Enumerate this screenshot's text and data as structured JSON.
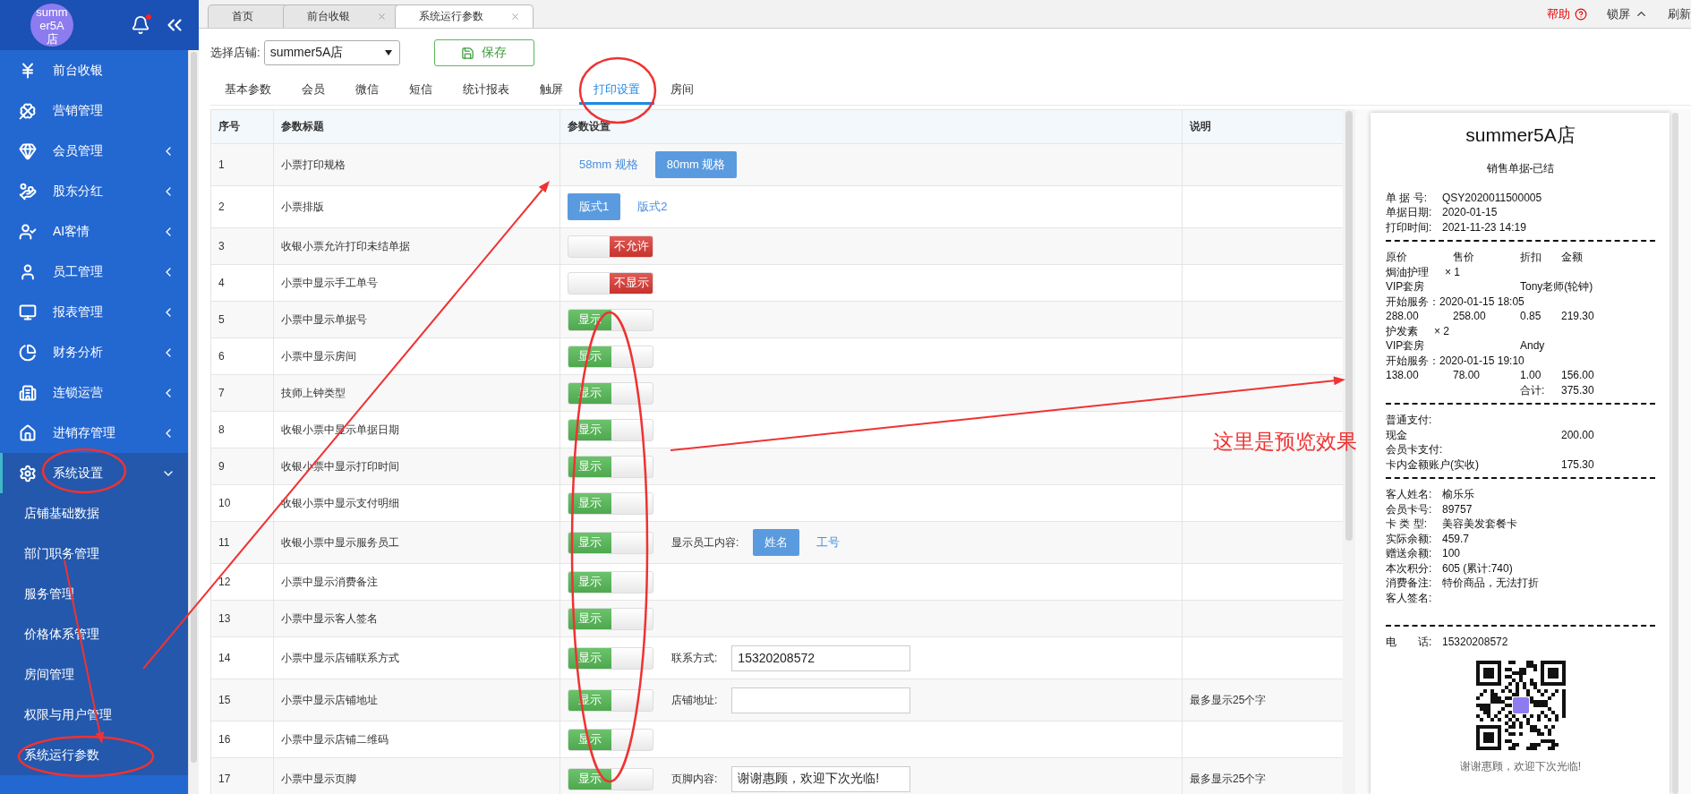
{
  "sidebar": {
    "shop_avatar": "summer5A店",
    "menu": [
      {
        "label": "前台收银",
        "kind": "link"
      },
      {
        "label": "营销管理",
        "kind": "link"
      },
      {
        "label": "会员管理",
        "kind": "group",
        "expanded": false
      },
      {
        "label": "股东分红",
        "kind": "group",
        "expanded": false
      },
      {
        "label": "AI客情",
        "kind": "group",
        "expanded": false
      },
      {
        "label": "员工管理",
        "kind": "group",
        "expanded": false
      },
      {
        "label": "报表管理",
        "kind": "group",
        "expanded": false
      },
      {
        "label": "财务分析",
        "kind": "group",
        "expanded": false
      },
      {
        "label": "连锁运营",
        "kind": "group",
        "expanded": false
      },
      {
        "label": "进销存管理",
        "kind": "group",
        "expanded": false
      },
      {
        "label": "系统设置",
        "kind": "group",
        "expanded": true,
        "children": [
          {
            "label": "店铺基础数据"
          },
          {
            "label": "部门职务管理"
          },
          {
            "label": "服务管理"
          },
          {
            "label": "价格体系管理"
          },
          {
            "label": "房间管理"
          },
          {
            "label": "权限与用户管理"
          },
          {
            "label": "系统运行参数"
          }
        ]
      }
    ]
  },
  "page_tabs": [
    {
      "label": "首页",
      "selected": false,
      "closable": false
    },
    {
      "label": "前台收银",
      "selected": false,
      "closable": true
    },
    {
      "label": "系统运行参数",
      "selected": true,
      "closable": true
    }
  ],
  "header_actions": [
    {
      "label": "帮助",
      "kind": "help"
    },
    {
      "label": "锁屏",
      "kind": "lock"
    },
    {
      "label": "刷新",
      "kind": "refresh"
    }
  ],
  "toolbar": {
    "store_label": "选择店铺:",
    "store_value": "summer5A店",
    "save": "保存"
  },
  "settings_tabs": [
    {
      "label": "基本参数",
      "selected": false
    },
    {
      "label": "会员",
      "selected": false
    },
    {
      "label": "微信",
      "selected": false
    },
    {
      "label": "短信",
      "selected": false
    },
    {
      "label": "统计报表",
      "selected": false
    },
    {
      "label": "触屏",
      "selected": false
    },
    {
      "label": "打印设置",
      "selected": true
    },
    {
      "label": "房间",
      "selected": false
    }
  ],
  "table": {
    "columns": [
      "序号",
      "参数标题",
      "参数设置",
      "说明"
    ],
    "rows": [
      {
        "no": "1",
        "title": "小票打印规格",
        "setting": {
          "kind": "choice",
          "options": [
            {
              "label": "58mm 规格",
              "selected": false
            },
            {
              "label": "80mm 规格",
              "selected": true
            }
          ]
        }
      },
      {
        "no": "2",
        "title": "小票排版",
        "setting": {
          "kind": "choice",
          "options": [
            {
              "label": "版式1",
              "selected": true
            },
            {
              "label": "版式2",
              "selected": false
            }
          ]
        }
      },
      {
        "no": "3",
        "title": "收银小票允许打印未结单据",
        "setting": {
          "kind": "toggle",
          "on": false,
          "label": "不允许"
        }
      },
      {
        "no": "4",
        "title": "小票中显示手工单号",
        "setting": {
          "kind": "toggle",
          "on": false,
          "label": "不显示"
        }
      },
      {
        "no": "5",
        "title": "小票中显示单据号",
        "setting": {
          "kind": "toggle",
          "on": true,
          "label": "显示"
        }
      },
      {
        "no": "6",
        "title": "小票中显示房间",
        "setting": {
          "kind": "toggle",
          "on": true,
          "label": "显示"
        }
      },
      {
        "no": "7",
        "title": "技师上钟类型",
        "setting": {
          "kind": "toggle",
          "on": true,
          "label": "显示"
        }
      },
      {
        "no": "8",
        "title": "收银小票中显示单据日期",
        "setting": {
          "kind": "toggle",
          "on": true,
          "label": "显示"
        }
      },
      {
        "no": "9",
        "title": "收银小票中显示打印时间",
        "setting": {
          "kind": "toggle",
          "on": true,
          "label": "显示"
        }
      },
      {
        "no": "10",
        "title": "收银小票中显示支付明细",
        "setting": {
          "kind": "toggle",
          "on": true,
          "label": "显示"
        }
      },
      {
        "no": "11",
        "title": "收银小票中显示服务员工",
        "setting": {
          "kind": "toggle",
          "on": true,
          "label": "显示"
        },
        "extra": {
          "kind": "choice",
          "label": "显示员工内容:",
          "options": [
            {
              "label": "姓名",
              "selected": true
            },
            {
              "label": "工号",
              "selected": false
            }
          ]
        }
      },
      {
        "no": "12",
        "title": "小票中显示消费备注",
        "setting": {
          "kind": "toggle",
          "on": true,
          "label": "显示"
        }
      },
      {
        "no": "13",
        "title": "小票中显示客人签名",
        "setting": {
          "kind": "toggle",
          "on": true,
          "label": "显示"
        }
      },
      {
        "no": "14",
        "title": "小票中显示店铺联系方式",
        "setting": {
          "kind": "toggle",
          "on": true,
          "label": "显示"
        },
        "extra": {
          "kind": "field",
          "label": "联系方式:",
          "value": "15320208572"
        }
      },
      {
        "no": "15",
        "title": "小票中显示店铺地址",
        "setting": {
          "kind": "toggle",
          "on": true,
          "label": "显示"
        },
        "extra": {
          "kind": "field",
          "label": "店铺地址:"
        },
        "note": "最多显示25个字"
      },
      {
        "no": "16",
        "title": "小票中显示店铺二维码",
        "setting": {
          "kind": "toggle",
          "on": true,
          "label": "显示"
        }
      },
      {
        "no": "17",
        "title": "小票中显示页脚",
        "setting": {
          "kind": "toggle",
          "on": true,
          "label": "显示"
        },
        "extra": {
          "kind": "field",
          "label": "页脚内容:",
          "value": "谢谢惠顾，欢迎下次光临!"
        },
        "note": "最多显示25个字"
      }
    ]
  },
  "receipt": {
    "shop_name": "summer5A店",
    "title": "销售单据-已结",
    "blocks": [
      {
        "lines": [
          {
            "kind": "pair",
            "cells": [
              "单 据 号:",
              "QSY2020011500005"
            ]
          },
          {
            "kind": "pair",
            "cells": [
              "单据日期:",
              "2020-01-15"
            ]
          },
          {
            "kind": "pair",
            "cells": [
              "打印时间:",
              "2021-11-23 14:19"
            ]
          }
        ]
      },
      {
        "lines": [
          {
            "kind": "grid",
            "cells": [
              "原价",
              "售价",
              "折扣",
              "金额"
            ]
          },
          {
            "kind": "item",
            "cells": [
              "焗油护理",
              "× 1"
            ]
          },
          {
            "kind": "grid",
            "cells": [
              "VIP套房",
              null,
              "Tony老师(轮钟)",
              null
            ]
          },
          {
            "kind": "text",
            "cells": [
              "开始服务：2020-01-15 18:05"
            ]
          },
          {
            "kind": "grid",
            "cells": [
              "288.00",
              "258.00",
              "0.85",
              "219.30"
            ]
          },
          {
            "kind": "item",
            "cells": [
              "护发素",
              "× 2"
            ]
          },
          {
            "kind": "grid",
            "cells": [
              "VIP套房",
              null,
              "Andy",
              null
            ]
          },
          {
            "kind": "text",
            "cells": [
              "开始服务：2020-01-15 19:10"
            ]
          },
          {
            "kind": "grid",
            "cells": [
              "138.00",
              "78.00",
              "1.00",
              "156.00"
            ]
          },
          {
            "kind": "grid",
            "cells": [
              null,
              null,
              "合计:",
              "375.30"
            ]
          }
        ]
      },
      {
        "lines": [
          {
            "kind": "text",
            "cells": [
              "普通支付:"
            ]
          },
          {
            "kind": "grid",
            "cells": [
              "现金",
              null,
              null,
              "200.00"
            ]
          },
          {
            "kind": "text",
            "cells": [
              "会员卡支付:"
            ]
          },
          {
            "kind": "grid",
            "cells": [
              "卡内金额账户(实收)",
              null,
              null,
              "175.30"
            ]
          }
        ]
      },
      {
        "lines": [
          {
            "kind": "pair",
            "cells": [
              "客人姓名:",
              "榆乐乐"
            ]
          },
          {
            "kind": "pair",
            "cells": [
              "会员卡号:",
              "89757"
            ]
          },
          {
            "kind": "pair",
            "cells": [
              "卡 类 型:",
              "美容美发套餐卡"
            ]
          },
          {
            "kind": "pair",
            "cells": [
              "实际余额:",
              "459.7"
            ]
          },
          {
            "kind": "pair",
            "cells": [
              "赠送余额:",
              "100"
            ]
          },
          {
            "kind": "pair",
            "cells": [
              "本次积分:",
              "605 (累计:740)"
            ]
          },
          {
            "kind": "pair",
            "cells": [
              "消费备注:",
              "特价商品，无法打折"
            ]
          },
          {
            "kind": "pair",
            "cells": [
              "客人签名:"
            ]
          }
        ]
      },
      {
        "lines": [
          {
            "kind": "pair",
            "cells": [
              "电　　话:",
              "15320208572"
            ]
          }
        ]
      }
    ],
    "footer": "谢谢惠顾，欢迎下次光临!"
  },
  "annotation": {
    "text": "这里是预览效果"
  }
}
